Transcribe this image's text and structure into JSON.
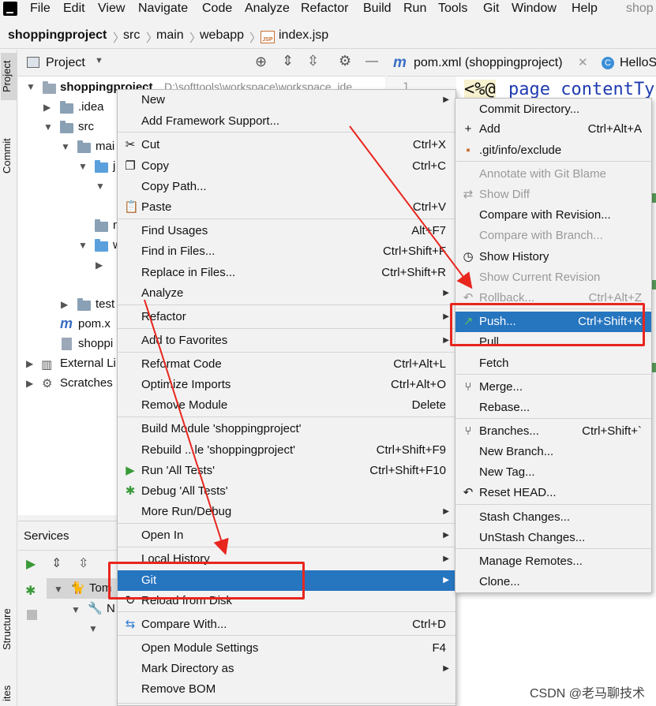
{
  "menubar": {
    "items": [
      "File",
      "Edit",
      "View",
      "Navigate",
      "Code",
      "Analyze",
      "Refactor",
      "Build",
      "Run",
      "Tools",
      "Git",
      "Window",
      "Help",
      "shop"
    ]
  },
  "breadcrumb": {
    "project": "shoppingproject",
    "parts": [
      "src",
      "main",
      "webapp"
    ],
    "file": "index.jsp",
    "file_icon_text": "JSP"
  },
  "sidebar_tabs": {
    "project": "Project",
    "commit": "Commit",
    "structure": "Structure",
    "favorites": "ites"
  },
  "project_panel": {
    "title": "Project",
    "root_name": "shoppingproject",
    "root_path": "D:\\softtools\\workspace\\workspace_ide",
    "rows": [
      ".idea",
      "src",
      "mai",
      "j",
      "",
      "n",
      "w",
      "",
      "",
      "test",
      "pom.x",
      "shoppi",
      "External Li",
      "Scratches"
    ]
  },
  "services": {
    "title": "Services",
    "rows": [
      "Tom",
      "N"
    ]
  },
  "editor": {
    "tabs": [
      "pom.xml (shoppingproject)",
      "HelloS"
    ],
    "line_number": "1",
    "code_prefix": "<%@",
    "code_keyword": "page contentTy"
  },
  "main_menu": {
    "items": [
      {
        "label": "New",
        "shortcut": "",
        "submenu": true,
        "icon": ""
      },
      {
        "label": "Add Framework Support...",
        "shortcut": "",
        "submenu": false,
        "icon": ""
      },
      {
        "label": "Cut",
        "shortcut": "Ctrl+X",
        "submenu": false,
        "icon": "scissors-icon"
      },
      {
        "label": "Copy",
        "shortcut": "Ctrl+C",
        "submenu": false,
        "icon": "copy-icon"
      },
      {
        "label": "Copy Path...",
        "shortcut": "",
        "submenu": false,
        "icon": ""
      },
      {
        "label": "Paste",
        "shortcut": "Ctrl+V",
        "submenu": false,
        "icon": "paste-icon"
      },
      {
        "label": "Find Usages",
        "shortcut": "Alt+F7",
        "submenu": false,
        "icon": ""
      },
      {
        "label": "Find in Files...",
        "shortcut": "Ctrl+Shift+F",
        "submenu": false,
        "icon": ""
      },
      {
        "label": "Replace in Files...",
        "shortcut": "Ctrl+Shift+R",
        "submenu": false,
        "icon": ""
      },
      {
        "label": "Analyze",
        "shortcut": "",
        "submenu": true,
        "icon": ""
      },
      {
        "label": "Refactor",
        "shortcut": "",
        "submenu": true,
        "icon": ""
      },
      {
        "label": "Add to Favorites",
        "shortcut": "",
        "submenu": true,
        "icon": ""
      },
      {
        "label": "Reformat Code",
        "shortcut": "Ctrl+Alt+L",
        "submenu": false,
        "icon": ""
      },
      {
        "label": "Optimize Imports",
        "shortcut": "Ctrl+Alt+O",
        "submenu": false,
        "icon": ""
      },
      {
        "label": "Remove Module",
        "shortcut": "Delete",
        "submenu": false,
        "icon": ""
      },
      {
        "label": "Build Module 'shoppingproject'",
        "shortcut": "",
        "submenu": false,
        "icon": ""
      },
      {
        "label": "Rebuild ...le 'shoppingproject'",
        "shortcut": "Ctrl+Shift+F9",
        "submenu": false,
        "icon": ""
      },
      {
        "label": "Run 'All Tests'",
        "shortcut": "Ctrl+Shift+F10",
        "submenu": false,
        "icon": "run-icon"
      },
      {
        "label": "Debug 'All Tests'",
        "shortcut": "",
        "submenu": false,
        "icon": "debug-icon"
      },
      {
        "label": "More Run/Debug",
        "shortcut": "",
        "submenu": true,
        "icon": ""
      },
      {
        "label": "Open In",
        "shortcut": "",
        "submenu": true,
        "icon": ""
      },
      {
        "label": "Local History",
        "shortcut": "",
        "submenu": true,
        "icon": ""
      },
      {
        "label": "Git",
        "shortcut": "",
        "submenu": true,
        "icon": ""
      },
      {
        "label": "Reload from Disk",
        "shortcut": "",
        "submenu": false,
        "icon": "reload-icon"
      },
      {
        "label": "Compare With...",
        "shortcut": "Ctrl+D",
        "submenu": false,
        "icon": "compare-icon"
      },
      {
        "label": "Open Module Settings",
        "shortcut": "F4",
        "submenu": false,
        "icon": ""
      },
      {
        "label": "Mark Directory as",
        "shortcut": "",
        "submenu": true,
        "icon": ""
      },
      {
        "label": "Remove BOM",
        "shortcut": "",
        "submenu": false,
        "icon": ""
      }
    ]
  },
  "git_menu": {
    "items": [
      {
        "label": "Commit Directory...",
        "shortcut": "",
        "disabled": false,
        "icon": ""
      },
      {
        "label": "Add",
        "shortcut": "Ctrl+Alt+A",
        "disabled": false,
        "icon": "plus-icon"
      },
      {
        "label": ".git/info/exclude",
        "shortcut": "",
        "disabled": false,
        "icon": "git-file-icon"
      },
      {
        "label": "Annotate with Git Blame",
        "shortcut": "",
        "disabled": true,
        "icon": ""
      },
      {
        "label": "Show Diff",
        "shortcut": "",
        "disabled": true,
        "icon": "diff-icon"
      },
      {
        "label": "Compare with Revision...",
        "shortcut": "",
        "disabled": false,
        "icon": ""
      },
      {
        "label": "Compare with Branch...",
        "shortcut": "",
        "disabled": true,
        "icon": ""
      },
      {
        "label": "Show History",
        "shortcut": "",
        "disabled": false,
        "icon": "clock-icon"
      },
      {
        "label": "Show Current Revision",
        "shortcut": "",
        "disabled": true,
        "icon": ""
      },
      {
        "label": "Rollback...",
        "shortcut": "Ctrl+Alt+Z",
        "disabled": true,
        "icon": "rollback-icon"
      },
      {
        "label": "Push...",
        "shortcut": "Ctrl+Shift+K",
        "disabled": false,
        "icon": "push-arrow-icon"
      },
      {
        "label": "Pull...",
        "shortcut": "",
        "disabled": false,
        "icon": ""
      },
      {
        "label": "Fetch",
        "shortcut": "",
        "disabled": false,
        "icon": ""
      },
      {
        "label": "Merge...",
        "shortcut": "",
        "disabled": false,
        "icon": "merge-icon"
      },
      {
        "label": "Rebase...",
        "shortcut": "",
        "disabled": false,
        "icon": ""
      },
      {
        "label": "Branches...",
        "shortcut": "Ctrl+Shift+`",
        "disabled": false,
        "icon": "branch-icon"
      },
      {
        "label": "New Branch...",
        "shortcut": "",
        "disabled": false,
        "icon": ""
      },
      {
        "label": "New Tag...",
        "shortcut": "",
        "disabled": false,
        "icon": ""
      },
      {
        "label": "Reset HEAD...",
        "shortcut": "",
        "disabled": false,
        "icon": "reset-icon"
      },
      {
        "label": "Stash Changes...",
        "shortcut": "",
        "disabled": false,
        "icon": ""
      },
      {
        "label": "UnStash Changes...",
        "shortcut": "",
        "disabled": false,
        "icon": ""
      },
      {
        "label": "Manage Remotes...",
        "shortcut": "",
        "disabled": false,
        "icon": ""
      },
      {
        "label": "Clone...",
        "shortcut": "",
        "disabled": false,
        "icon": ""
      }
    ]
  },
  "watermark": "CSDN @老马聊技术",
  "colors": {
    "selection": "#2675bf",
    "highlight": "#e8261e",
    "menu_bg": "#f2f2f2"
  }
}
